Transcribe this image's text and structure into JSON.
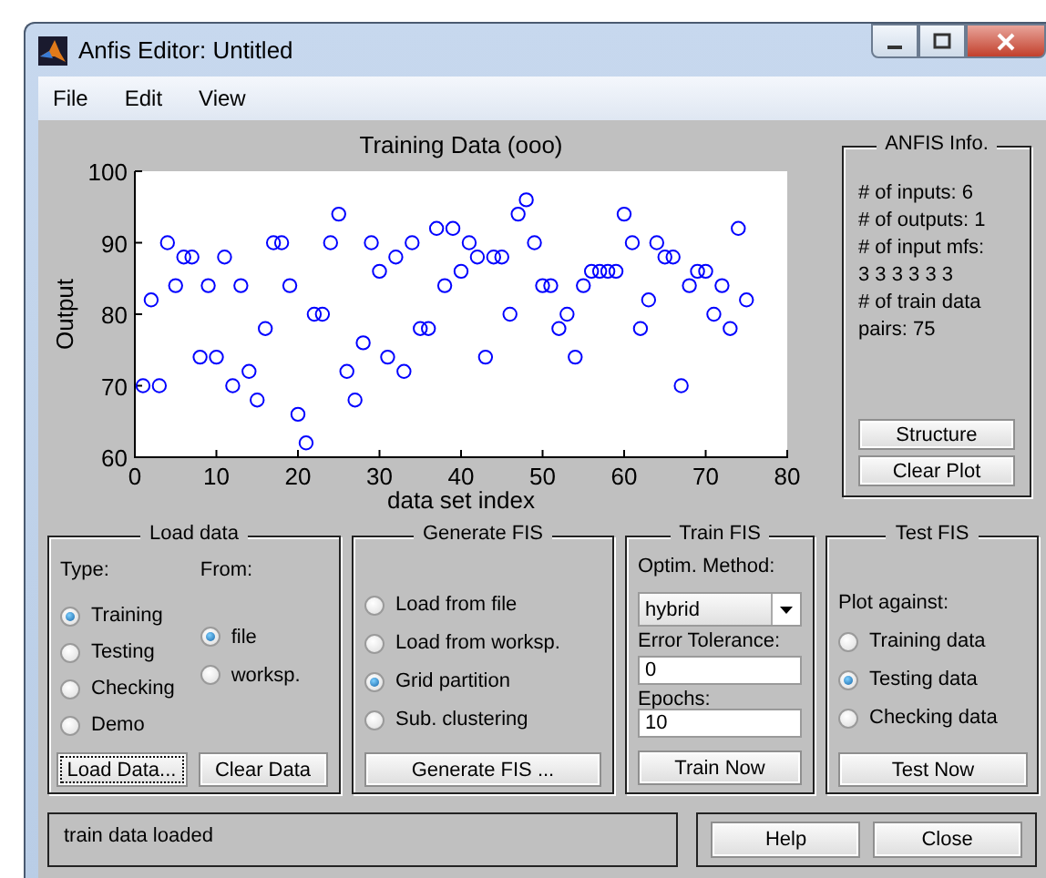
{
  "window": {
    "title": "Anfis Editor: Untitled"
  },
  "menu": [
    "File",
    "Edit",
    "View"
  ],
  "plot": {
    "chart_data": {
      "type": "scatter",
      "title": "Training Data (ooo)",
      "xlabel": "data set index",
      "ylabel": "Output",
      "x": [
        1,
        2,
        3,
        4,
        5,
        6,
        7,
        8,
        9,
        10,
        11,
        12,
        13,
        14,
        15,
        16,
        17,
        18,
        19,
        20,
        21,
        22,
        23,
        24,
        25,
        26,
        27,
        28,
        29,
        30,
        31,
        32,
        33,
        34,
        35,
        36,
        37,
        38,
        39,
        40,
        41,
        42,
        43,
        44,
        45,
        46,
        47,
        48,
        49,
        50,
        51,
        52,
        53,
        54,
        55,
        56,
        57,
        58,
        59,
        60,
        61,
        62,
        63,
        64,
        65,
        66,
        67,
        68,
        69,
        70,
        71,
        72,
        73,
        74,
        75
      ],
      "series": [
        {
          "color": "#0000ff",
          "values": [
            70,
            82,
            70,
            90,
            84,
            88,
            88,
            74,
            84,
            74,
            88,
            70,
            84,
            72,
            68,
            78,
            90,
            90,
            84,
            66,
            62,
            80,
            80,
            90,
            94,
            72,
            68,
            76,
            90,
            86,
            74,
            88,
            72,
            90,
            78,
            78,
            92,
            84,
            92,
            86,
            90,
            88,
            74,
            88,
            88,
            80,
            94,
            96,
            90,
            84,
            84,
            78,
            80,
            74,
            84,
            86,
            86,
            86,
            86,
            94,
            90,
            78,
            82,
            90,
            88,
            88,
            70,
            84,
            86,
            86,
            80,
            84,
            78,
            92,
            82
          ]
        }
      ],
      "xlim": [
        0,
        80
      ],
      "ylim": [
        60,
        100
      ],
      "xticks": [
        0,
        10,
        20,
        30,
        40,
        50,
        60,
        70,
        80
      ],
      "yticks": [
        60,
        70,
        80,
        90,
        100
      ]
    }
  },
  "info": {
    "title": "ANFIS Info.",
    "lines": [
      "# of inputs: 6",
      "# of outputs: 1",
      "# of input mfs:",
      "3 3 3 3 3 3",
      "# of train data",
      "pairs: 75"
    ],
    "buttons": [
      "Structure",
      "Clear Plot"
    ]
  },
  "load_data": {
    "title": "Load data",
    "type_label": "Type:",
    "from_label": "From:",
    "types": [
      {
        "label": "Training",
        "selected": true
      },
      {
        "label": "Testing",
        "selected": false
      },
      {
        "label": "Checking",
        "selected": false
      },
      {
        "label": "Demo",
        "selected": false
      }
    ],
    "sources": [
      {
        "label": "file",
        "selected": true
      },
      {
        "label": "worksp.",
        "selected": false
      }
    ],
    "buttons": [
      {
        "label": "Load Data...",
        "focused": true
      },
      {
        "label": "Clear Data",
        "focused": false
      }
    ]
  },
  "generate_fis": {
    "title": "Generate FIS",
    "options": [
      {
        "label": "Load from file",
        "selected": false
      },
      {
        "label": "Load from worksp.",
        "selected": false
      },
      {
        "label": "Grid partition",
        "selected": true
      },
      {
        "label": "Sub. clustering",
        "selected": false
      }
    ],
    "button": "Generate FIS ..."
  },
  "train_fis": {
    "title": "Train FIS",
    "method_label": "Optim. Method:",
    "method": "hybrid",
    "tolerance_label": "Error Tolerance:",
    "tolerance": "0",
    "epochs_label": "Epochs:",
    "epochs": "10",
    "button": "Train Now"
  },
  "test_fis": {
    "title": "Test FIS",
    "plot_label": "Plot against:",
    "options": [
      {
        "label": "Training data",
        "selected": false
      },
      {
        "label": "Testing data",
        "selected": true
      },
      {
        "label": "Checking data",
        "selected": false
      }
    ],
    "button": "Test Now"
  },
  "status": "train data loaded",
  "buttons": [
    "Help",
    "Close"
  ]
}
